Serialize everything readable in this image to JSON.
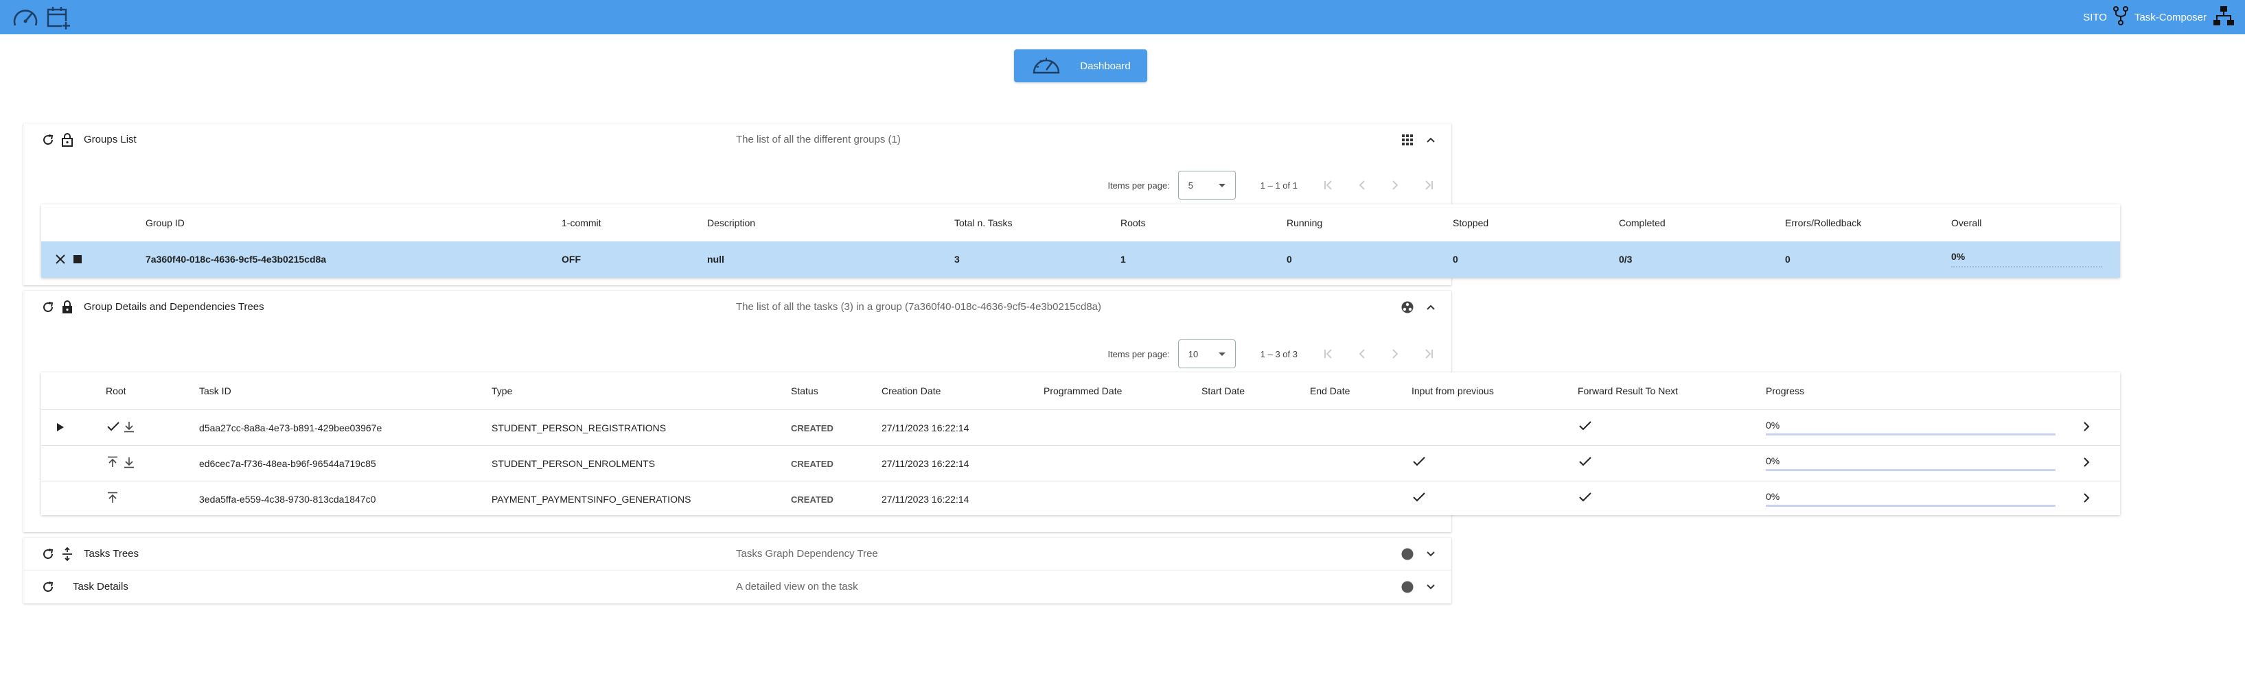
{
  "topbar": {
    "left_icons": [
      "speedometer-icon",
      "calendar-plus-icon"
    ],
    "user": "SITO",
    "app_name": "Task-Composer",
    "colors": {
      "bar": "#4a9be9"
    }
  },
  "dashboard_button": {
    "label": "Dashboard",
    "icon": "speedometer-icon"
  },
  "groups_panel": {
    "title": "Groups List",
    "description": "The list of all the different groups (1)",
    "paginator": {
      "items_per_page_label": "Items per page:",
      "items_per_page": "5",
      "range": "1 – 1 of 1"
    },
    "columns": [
      "Group ID",
      "1-commit",
      "Description",
      "Total n. Tasks",
      "Roots",
      "Running",
      "Stopped",
      "Completed",
      "Errors/Rolledback",
      "Overall"
    ],
    "rows": [
      {
        "group_id": "7a360f40-018c-4636-9cf5-4e3b0215cd8a",
        "one_commit": "OFF",
        "description": "null",
        "total_tasks": "3",
        "roots": "1",
        "running": "0",
        "stopped": "0",
        "completed": "0/3",
        "errors": "0",
        "overall": "0%",
        "overall_fraction": 0
      }
    ]
  },
  "details_panel": {
    "title": "Group Details and Dependencies Trees",
    "description": "The list of all the tasks (3) in a group (7a360f40-018c-4636-9cf5-4e3b0215cd8a)",
    "paginator": {
      "items_per_page_label": "Items per page:",
      "items_per_page": "10",
      "range": "1 – 3 of 3"
    },
    "columns": [
      "Root",
      "Task ID",
      "Type",
      "Status",
      "Creation Date",
      "Programmed Date",
      "Start Date",
      "End Date",
      "Input from previous",
      "Forward Result To Next",
      "Progress"
    ],
    "rows": [
      {
        "task_id": "d5aa27cc-8a8a-4e73-b891-429bee03967e",
        "type": "STUDENT_PERSON_REGISTRATIONS",
        "status": "CREATED",
        "creation_date": "27/11/2023 16:22:14",
        "programmed_date": "",
        "start_date": "",
        "end_date": "",
        "input_from_previous": false,
        "forward_result": true,
        "progress": "0%",
        "progress_fraction": 0
      },
      {
        "task_id": "ed6cec7a-f736-48ea-b96f-96544a719c85",
        "type": "STUDENT_PERSON_ENROLMENTS",
        "status": "CREATED",
        "creation_date": "27/11/2023 16:22:14",
        "programmed_date": "",
        "start_date": "",
        "end_date": "",
        "input_from_previous": true,
        "forward_result": true,
        "progress": "0%",
        "progress_fraction": 0
      },
      {
        "task_id": "3eda5ffa-e559-4c38-9730-813cda1847c0",
        "type": "PAYMENT_PAYMENTSINFO_GENERATIONS",
        "status": "CREATED",
        "creation_date": "27/11/2023 16:22:14",
        "programmed_date": "",
        "start_date": "",
        "end_date": "",
        "input_from_previous": true,
        "forward_result": true,
        "progress": "0%",
        "progress_fraction": 0
      }
    ]
  },
  "trees_panel": {
    "title": "Tasks Trees",
    "description": "Tasks Graph Dependency Tree"
  },
  "task_details_panel": {
    "title": "Task Details",
    "description": "A detailed view on the task"
  }
}
